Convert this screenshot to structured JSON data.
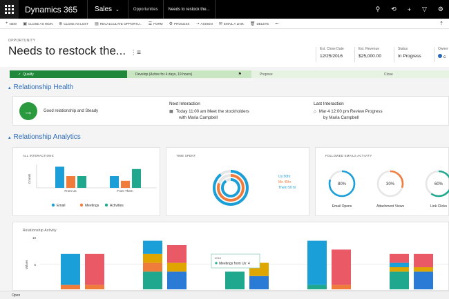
{
  "nav": {
    "app_name": "Dynamics 365",
    "area": "Sales",
    "crumbs": [
      "Opportunities",
      "Needs to restock the..."
    ]
  },
  "commands": [
    {
      "icon": "+",
      "label": "NEW"
    },
    {
      "icon": "▣",
      "label": "CLOSE AS WON"
    },
    {
      "icon": "⊗",
      "label": "CLOSE AS LOST"
    },
    {
      "icon": "▤",
      "label": "RECALCULATE OPPORTU..."
    },
    {
      "icon": "☰",
      "label": "FORM"
    },
    {
      "icon": "⚙",
      "label": "PROCESS"
    },
    {
      "icon": "⇢",
      "label": "ASSIGN"
    },
    {
      "icon": "✉",
      "label": "EMAIL A LINK"
    },
    {
      "icon": "🗑",
      "label": "DELETE"
    },
    {
      "icon": "",
      "label": "•••"
    }
  ],
  "header": {
    "entity": "OPPORTUNITY",
    "title": "Needs to restock the...",
    "fields": [
      {
        "label": "Est. Close Date",
        "value": "12/25/2016"
      },
      {
        "label": "Est. Revenue",
        "value": "$25,000.00"
      },
      {
        "label": "Status",
        "value": "In Progress"
      },
      {
        "label": "Owner",
        "value": "c"
      }
    ]
  },
  "process": {
    "stages": [
      "Qualify",
      "Develop (Active for 4 days, 19 hours)",
      "Propose",
      "Close"
    ]
  },
  "health": {
    "section_title": "Relationship Health",
    "status": "Good relationship and Steady",
    "next": {
      "heading": "Next Interaction",
      "line1": "Today 11:00 am   Meet the stockholders",
      "line2": "with Maria Campbell"
    },
    "last": {
      "heading": "Last Interaction",
      "line1": "Mar 4 12:00 pm   Review Progress",
      "line2": "by Maria Campbell"
    }
  },
  "analytics": {
    "section_title": "Relationship Analytics",
    "all_interactions": {
      "title": "ALL INTERACTIONS",
      "ylabel": "Counts",
      "categories": [
        "From Us",
        "From Them"
      ],
      "legend": [
        "Email",
        "Meetings",
        "Activities"
      ]
    },
    "time_spent": {
      "title": "TIME SPENT",
      "legend": [
        "Us 50hr",
        "Me 45hr",
        "Them 50 hr"
      ]
    },
    "followed_email": {
      "title": "FOLLOWED EMAILS ACTIVITY",
      "items": [
        {
          "label": "Email Opens",
          "value": "80%"
        },
        {
          "label": "Attachment Views",
          "value": "30%"
        },
        {
          "label": "Link Clicks",
          "value": "60%"
        }
      ]
    },
    "relationship_activity": {
      "title": "Relationship Activity",
      "ylabel": "Values",
      "y_ticks": [
        "10",
        "5"
      ],
      "tooltip": {
        "line1": "2016",
        "line2": "Meetings from Us: 4"
      }
    }
  },
  "statusbar": {
    "label": "Open"
  },
  "colors": {
    "email": "#1a9fd9",
    "meetings": "#f07c3c",
    "activities": "#1fa88d",
    "red": "#e95a66",
    "gold": "#e0a600",
    "blue": "#2a7bd6"
  },
  "chart_data": [
    {
      "type": "bar",
      "title": "ALL INTERACTIONS",
      "ylabel": "Counts",
      "categories": [
        "From Us",
        "From Them"
      ],
      "series": [
        {
          "name": "Email",
          "values": [
            9,
            5
          ]
        },
        {
          "name": "Meetings",
          "values": [
            5,
            3
          ]
        },
        {
          "name": "Activities",
          "values": [
            5,
            8
          ]
        }
      ],
      "ylim": [
        0,
        10
      ],
      "legend": "bottom"
    },
    {
      "type": "pie",
      "title": "TIME SPENT",
      "labels": [
        "Us 50hr",
        "Me 45hr",
        "Them 50 hr"
      ],
      "values": [
        50,
        45,
        50
      ]
    },
    {
      "type": "bar",
      "title": "FOLLOWED EMAILS ACTIVITY",
      "categories": [
        "Email Opens",
        "Attachment Views",
        "Link Clicks"
      ],
      "values": [
        80,
        30,
        60
      ],
      "ylim": [
        0,
        100
      ]
    },
    {
      "type": "bar",
      "title": "Relationship Activity",
      "ylabel": "Values",
      "y_ticks": [
        10,
        5
      ],
      "groups": [
        {
          "bars": [
            {
              "segments": [
                {
                  "color": "email",
                  "value": 7
                },
                {
                  "color": "meetings",
                  "value": 1
                }
              ]
            },
            {
              "segments": [
                {
                  "color": "red",
                  "value": 7
                },
                {
                  "color": "meetings",
                  "value": 1
                }
              ]
            }
          ]
        },
        {
          "bars": [
            {
              "segments": [
                {
                  "color": "email",
                  "value": 3
                },
                {
                  "color": "gold",
                  "value": 2
                },
                {
                  "color": "meetings",
                  "value": 2
                },
                {
                  "color": "activities",
                  "value": 4
                }
              ]
            },
            {
              "segments": [
                {
                  "color": "red",
                  "value": 4
                },
                {
                  "color": "gold",
                  "value": 2
                },
                {
                  "color": "blue",
                  "value": 4
                }
              ]
            }
          ]
        },
        {
          "bars": [
            {
              "segments": [
                {
                  "color": "activities",
                  "value": 4
                }
              ]
            },
            {
              "segments": [
                {
                  "color": "gold",
                  "value": 3
                },
                {
                  "color": "blue",
                  "value": 3
                }
              ]
            }
          ]
        },
        {
          "bars": [
            {
              "segments": [
                {
                  "color": "email",
                  "value": 10
                },
                {
                  "color": "activities",
                  "value": 1
                }
              ]
            },
            {
              "segments": [
                {
                  "color": "red",
                  "value": 8
                },
                {
                  "color": "meetings",
                  "value": 1
                }
              ]
            }
          ]
        },
        {
          "bars": [
            {
              "segments": [
                {
                  "color": "red",
                  "value": 2
                },
                {
                  "color": "email",
                  "value": 1
                },
                {
                  "color": "gold",
                  "value": 1
                },
                {
                  "color": "activities",
                  "value": 4
                }
              ]
            },
            {
              "segments": [
                {
                  "color": "red",
                  "value": 3
                },
                {
                  "color": "gold",
                  "value": 1
                },
                {
                  "color": "blue",
                  "value": 4
                }
              ]
            }
          ]
        }
      ]
    }
  ]
}
